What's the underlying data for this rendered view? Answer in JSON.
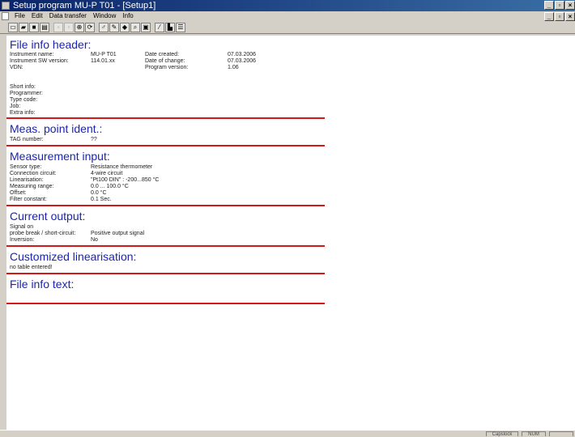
{
  "window": {
    "title": "Setup program MU-P T01 - [Setup1]"
  },
  "menu": [
    "File",
    "Edit",
    "Data transfer",
    "Window",
    "Info"
  ],
  "toolbar_icons": [
    "new-file-icon",
    "open-file-icon",
    "save-icon",
    "print-icon",
    "cut-icon",
    "copy-icon",
    "paste-icon",
    "refresh-icon",
    "zoom-icon",
    "pen-icon",
    "arrow-icon",
    "diamond-icon",
    "search-icon",
    "monitor-icon",
    "line-icon",
    "chart-icon",
    "list-icon"
  ],
  "file_info": {
    "heading": "File info header:",
    "instrument_name_label": "Instrument name:",
    "instrument_name": "MU-P T01",
    "sw_version_label": "Instrument SW version:",
    "sw_version": "114.01.xx",
    "vdn_label": "VDN:",
    "date_created_label": "Date created:",
    "date_created": "07.03.2006",
    "date_change_label": "Date of change:",
    "date_change": "07.03.2006",
    "program_version_label": "Program version:",
    "program_version": "1.06",
    "short_info_label": "Short info:",
    "programmer_label": "Programmer:",
    "type_code_label": "Type code:",
    "job_label": "Job:",
    "extra_info_label": "Extra info:"
  },
  "meas_point": {
    "heading": "Meas. point ident.:",
    "tag_label": "TAG number:",
    "tag_value": "??"
  },
  "measurement_input": {
    "heading": "Measurement input:",
    "rows": [
      {
        "label": "Sensor type:",
        "value": "Resistance thermometer"
      },
      {
        "label": "Connection circuit:",
        "value": "4-wire circuit"
      },
      {
        "label": "Linearisation:",
        "value": "\"Pt100 DIN\" : -200...850 °C"
      },
      {
        "label": "Measuring range:",
        "value": "0.0 ... 100.0 °C"
      },
      {
        "label": "Offset:",
        "value": "0.0 °C"
      },
      {
        "label": "Filter constant:",
        "value": "0.1 Sec."
      }
    ]
  },
  "current_output": {
    "heading": "Current output:",
    "signal_label": "Signal on",
    "rows": [
      {
        "label": "probe break / short-circuit:",
        "value": "Positive output signal"
      },
      {
        "label": "Inversion:",
        "value": "No"
      }
    ]
  },
  "customized_linearisation": {
    "heading": "Customized linearisation:",
    "note": "no table entered!"
  },
  "file_info_text": {
    "heading": "File info text:"
  },
  "status": {
    "capslock": "Capslock",
    "num": "NUM"
  }
}
